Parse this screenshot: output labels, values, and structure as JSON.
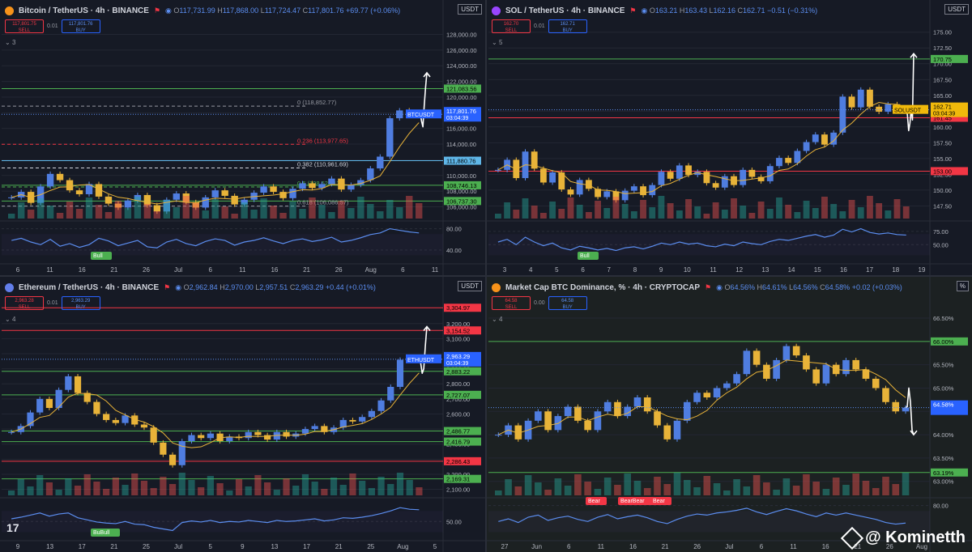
{
  "watermark": "@ Kominetth",
  "charts": [
    {
      "header": {
        "title": "Bitcoin / TetherUS · 4h · BINANCE",
        "o": "117,731.99",
        "h": "117,868.00",
        "l": "117,724.47",
        "c": "117,801.76",
        "chg": "+69.77 (+0.06%)"
      },
      "trade": {
        "sell": "117,801.75",
        "buy": "117,801.76",
        "spread": "0.01",
        "sell_label": "SELL",
        "buy_label": "BUY"
      },
      "currency": "USDT",
      "collapse": "3",
      "logo_color": "#f7931a",
      "accent": "#2962ff"
    },
    {
      "header": {
        "title": "SOL / TetherUS · 4h · BINANCE",
        "o": "163.21",
        "h": "163.43",
        "l": "162.16",
        "c": "162.71",
        "chg": "−0.51 (−0.31%)"
      },
      "trade": {
        "sell": "162.70",
        "buy": "162.71",
        "spread": "0.01",
        "sell_label": "SELL",
        "buy_label": "BUY"
      },
      "currency": "USDT",
      "collapse": "5",
      "logo_color": "#9945ff",
      "accent": "#2962ff"
    },
    {
      "header": {
        "title": "Ethereum / TetherUS · 4h · BINANCE",
        "o": "2,962.84",
        "h": "2,970.00",
        "l": "2,957.51",
        "c": "2,963.29",
        "chg": "+0.44 (+0.01%)"
      },
      "trade": {
        "sell": "2,963.28",
        "buy": "2,963.29",
        "spread": "0.01",
        "sell_label": "SELL",
        "buy_label": "BUY"
      },
      "currency": "USDT",
      "collapse": "4",
      "logo_color": "#627eea",
      "accent": "#2962ff"
    },
    {
      "header": {
        "title": "Market Cap BTC Dominance, % · 4h · CRYPTOCAP",
        "o": "64.56%",
        "h": "64.61%",
        "l": "64.56%",
        "c": "64.58%",
        "chg": "+0.02 (+0.03%)"
      },
      "trade": {
        "sell": "64.58",
        "buy": "64.58",
        "spread": "0.00",
        "sell_label": "SELL",
        "buy_label": "BUY"
      },
      "currency": "%",
      "collapse": "4",
      "logo_color": "#f7931a",
      "accent": "#2962ff"
    }
  ],
  "chart_data": [
    {
      "type": "candlestick",
      "symbol": "BTCUSDT",
      "ylim": [
        104500,
        129500
      ],
      "y_ticks": [
        128000,
        126000,
        124000,
        122000,
        120000,
        118000,
        116000,
        114000,
        112000,
        110000,
        108000,
        106000
      ],
      "y_tick_labels": [
        "128,000.00",
        "126,000.00",
        "124,000.00",
        "122,000.00",
        "120,000.00",
        "118,000.00",
        "116,000.00",
        "114,000.00",
        "112,000.00",
        "110,000.00",
        "108,000.00",
        "106,000.00"
      ],
      "x_labels": [
        "6",
        "11",
        "16",
        "21",
        "26",
        "Jul",
        "6",
        "11",
        "16",
        "21",
        "26",
        "Aug",
        "6",
        "11"
      ],
      "price_tag": {
        "label": "BTCUSDT",
        "value": "117,801.76",
        "timer": "03:04:39",
        "price": 117801.76
      },
      "levels": [
        {
          "price": 121083.56,
          "label": "121,083.56",
          "color": "#4caf50",
          "style": "solid"
        },
        {
          "price": 111880.76,
          "label": "111,880.76",
          "color": "#5fb6e8",
          "style": "solid"
        },
        {
          "price": 108746.13,
          "label": "108,746.13",
          "color": "#4caf50",
          "style": "solid"
        },
        {
          "price": 106737.3,
          "label": "106,737.30",
          "color": "#4caf50",
          "style": "solid"
        }
      ],
      "fib": [
        {
          "price": 118852.77,
          "text": "0 (118,852.77)",
          "color": "#9598a1"
        },
        {
          "price": 113977.65,
          "text": "0.236 (113,977.65)",
          "color": "#f23645"
        },
        {
          "price": 110961.69,
          "text": "0.382 (110,961.69)",
          "color": "#d1d4dc"
        },
        {
          "price": 108524.13,
          "text": "0.5 (108,524.13)",
          "color": "#4caf50"
        },
        {
          "price": 106086.57,
          "text": "0.618 (106,086.57)",
          "color": "#9598a1"
        }
      ],
      "closes": [
        107200,
        107900,
        106500,
        108600,
        110200,
        109400,
        108100,
        107600,
        108900,
        107300,
        106400,
        105900,
        106800,
        107500,
        106200,
        105400,
        106900,
        107700,
        106600,
        105900,
        107200,
        108100,
        107400,
        106300,
        106900,
        107800,
        108600,
        107900,
        107100,
        108300,
        109000,
        108400,
        108900,
        109600,
        108200,
        108800,
        109400,
        110900,
        112400,
        117300,
        118300,
        117900,
        117801
      ],
      "arrow_path": [
        118000,
        116900,
        116200,
        118900,
        121200,
        123100
      ],
      "rsi": {
        "ticks": [
          80,
          40
        ],
        "tick_labels": [
          "80.00",
          "40.00"
        ],
        "badge": "Bull",
        "values": [
          58,
          62,
          55,
          50,
          60,
          47,
          52,
          45,
          50,
          62,
          57,
          48,
          53,
          58,
          46,
          44,
          55,
          60,
          52,
          48,
          56,
          61,
          58,
          49,
          55,
          58,
          63,
          57,
          52,
          58,
          61,
          56,
          59,
          64,
          55,
          58,
          63,
          69,
          72,
          80,
          77,
          74,
          72
        ]
      }
    },
    {
      "type": "candlestick",
      "symbol": "SOLUSDT",
      "ylim": [
        145500,
        176500
      ],
      "scale": 1000,
      "y_ticks": [
        175,
        172.5,
        170,
        167.5,
        165,
        162.5,
        160,
        157.5,
        155,
        152.5,
        150,
        147.5
      ],
      "y_tick_labels": [
        "175.00",
        "172.50",
        "170.00",
        "167.50",
        "165.00",
        "162.50",
        "160.00",
        "157.50",
        "155.00",
        "152.50",
        "150.00",
        "147.50"
      ],
      "x_labels": [
        "3",
        "4",
        "5",
        "6",
        "7",
        "8",
        "9",
        "10",
        "11",
        "12",
        "13",
        "14",
        "15",
        "16",
        "17",
        "18",
        "19"
      ],
      "price_tag": {
        "label": "SOLUSDT",
        "value": "162.71",
        "timer": "03:04:39",
        "price": 162.71
      },
      "levels": [
        {
          "price": 170.75,
          "label": "170.75",
          "color": "#4caf50",
          "style": "solid"
        },
        {
          "price": 161.45,
          "label": "161.45",
          "color": "#f23645",
          "style": "solid"
        },
        {
          "price": 153.0,
          "label": "153.00",
          "color": "#f23645",
          "style": "solid"
        }
      ],
      "closes": [
        153.2,
        154.8,
        151.9,
        156.1,
        153.4,
        151.2,
        152.8,
        150.1,
        149.3,
        151.6,
        150.2,
        148.9,
        149.8,
        148.4,
        149.9,
        150.6,
        149.2,
        150.8,
        152.9,
        151.8,
        153.9,
        152.4,
        152.9,
        151.1,
        150.4,
        152.2,
        150.8,
        153.2,
        152.1,
        151.4,
        153.8,
        155.1,
        154.3,
        156.2,
        157.6,
        158.8,
        157.2,
        159.1,
        164.8,
        163.1,
        165.9,
        163.2,
        162.4,
        163.6,
        162.8,
        162.71
      ],
      "arrow_path": [
        161.9,
        159.4,
        160.6,
        162.8,
        161.1,
        171.6
      ],
      "rsi": {
        "ticks": [
          75,
          50
        ],
        "tick_labels": [
          "75.00",
          "50.00"
        ],
        "badge": "Bull",
        "values": [
          55,
          60,
          50,
          64,
          55,
          48,
          53,
          44,
          40,
          47,
          44,
          40,
          43,
          39,
          44,
          46,
          42,
          47,
          53,
          50,
          55,
          51,
          53,
          48,
          46,
          51,
          48,
          55,
          52,
          50,
          56,
          60,
          58,
          62,
          66,
          69,
          64,
          68,
          79,
          74,
          80,
          73,
          70,
          72,
          69,
          68
        ]
      }
    },
    {
      "type": "candlestick",
      "symbol": "ETHUSDT",
      "ylim": [
        2060,
        3360
      ],
      "y_ticks": [
        3200,
        3100,
        3000,
        2900,
        2800,
        2700,
        2600,
        2500,
        2400,
        2300,
        2200,
        2100
      ],
      "y_tick_labels": [
        "3,200.00",
        "3,100.00",
        "3,000.00",
        "2,900.00",
        "2,800.00",
        "2,700.00",
        "2,600.00",
        "2,500.00",
        "2,400.00",
        "2,300.00",
        "2,200.00",
        "2,100.00"
      ],
      "x_labels": [
        "9",
        "13",
        "17",
        "21",
        "25",
        "Jul",
        "5",
        "9",
        "13",
        "17",
        "21",
        "25",
        "Aug",
        "5"
      ],
      "price_tag": {
        "label": "ETHUSDT",
        "value": "2,963.29",
        "timer": "03:04:39",
        "price": 2963.29
      },
      "levels": [
        {
          "price": 3304.97,
          "label": "3,304.97",
          "color": "#f23645",
          "style": "solid"
        },
        {
          "price": 3154.52,
          "label": "3,154.52",
          "color": "#f23645",
          "style": "solid"
        },
        {
          "price": 2883.22,
          "label": "2,883.22",
          "color": "#4caf50",
          "style": "solid"
        },
        {
          "price": 2727.07,
          "label": "2,727.07",
          "color": "#4caf50",
          "style": "solid"
        },
        {
          "price": 2486.77,
          "label": "2,486.77",
          "color": "#4caf50",
          "style": "solid"
        },
        {
          "price": 2416.79,
          "label": "2,416.79",
          "color": "#4caf50",
          "style": "solid"
        },
        {
          "price": 2286.43,
          "label": "2,286.43",
          "color": "#f23645",
          "style": "solid"
        },
        {
          "price": 2169.31,
          "label": "2,169.31",
          "color": "#4caf50",
          "style": "solid"
        }
      ],
      "closes": [
        2480,
        2520,
        2610,
        2700,
        2640,
        2760,
        2850,
        2740,
        2680,
        2600,
        2560,
        2540,
        2590,
        2530,
        2510,
        2410,
        2330,
        2260,
        2420,
        2460,
        2440,
        2470,
        2420,
        2450,
        2440,
        2480,
        2460,
        2430,
        2480,
        2450,
        2470,
        2500,
        2520,
        2480,
        2510,
        2560,
        2550,
        2580,
        2620,
        2690,
        2780,
        2960,
        2970,
        2963
      ],
      "arrow_path": [
        2940,
        2870,
        2900,
        3050,
        3180
      ],
      "rsi": {
        "ticks": [
          50
        ],
        "tick_labels": [
          "50.00"
        ],
        "badge": "BuBull",
        "values": [
          55,
          58,
          62,
          66,
          60,
          64,
          66,
          57,
          53,
          49,
          47,
          46,
          50,
          45,
          44,
          39,
          36,
          33,
          48,
          51,
          49,
          52,
          48,
          50,
          49,
          52,
          50,
          48,
          52,
          50,
          51,
          53,
          55,
          51,
          53,
          57,
          56,
          58,
          61,
          65,
          70,
          76,
          73,
          72
        ]
      }
    },
    {
      "type": "candlestick",
      "symbol": "BTC.D",
      "ylim": [
        62.7,
        66.9
      ],
      "y_ticks": [
        66.5,
        66.0,
        65.5,
        65.0,
        64.5,
        64.0,
        63.5,
        63.0
      ],
      "y_tick_labels": [
        "66.50%",
        "66.00%",
        "65.50%",
        "65.00%",
        "64.50%",
        "64.00%",
        "63.50%",
        "63.00%"
      ],
      "x_labels": [
        "27",
        "Jun",
        "6",
        "11",
        "16",
        "21",
        "26",
        "Jul",
        "6",
        "11",
        "16",
        "21",
        "26",
        "Aug"
      ],
      "price_tag": {
        "label": "",
        "value": "64.58%",
        "timer": "",
        "price": 64.58
      },
      "levels": [
        {
          "price": 66.0,
          "label": "66.00%",
          "color": "#4caf50",
          "style": "solid"
        },
        {
          "price": 63.19,
          "label": "63.19%",
          "color": "#4caf50",
          "style": "solid"
        }
      ],
      "closes": [
        64.0,
        64.2,
        63.9,
        64.3,
        64.5,
        64.1,
        64.4,
        64.6,
        64.3,
        64.1,
        64.5,
        64.7,
        64.4,
        64.6,
        64.8,
        64.5,
        64.2,
        63.9,
        64.3,
        64.7,
        64.9,
        64.8,
        65.0,
        65.1,
        65.3,
        65.8,
        65.5,
        65.2,
        65.6,
        65.9,
        65.7,
        65.4,
        65.1,
        65.5,
        65.3,
        65.6,
        65.4,
        65.2,
        65.0,
        64.7,
        64.5,
        64.58
      ],
      "arrow_path": [
        64.6,
        65.0,
        64.7,
        64.1,
        64.0
      ],
      "rsi": {
        "ticks": [
          80
        ],
        "tick_labels": [
          "80.00"
        ],
        "badges": [
          "Bear",
          "BearBear",
          "Bear"
        ],
        "values": [
          50,
          55,
          48,
          58,
          62,
          52,
          57,
          60,
          54,
          50,
          58,
          63,
          55,
          59,
          62,
          57,
          50,
          46,
          54,
          60,
          64,
          62,
          66,
          68,
          71,
          75,
          68,
          63,
          69,
          74,
          70,
          64,
          59,
          66,
          62,
          66,
          62,
          58,
          54,
          48,
          45,
          47
        ]
      }
    }
  ]
}
